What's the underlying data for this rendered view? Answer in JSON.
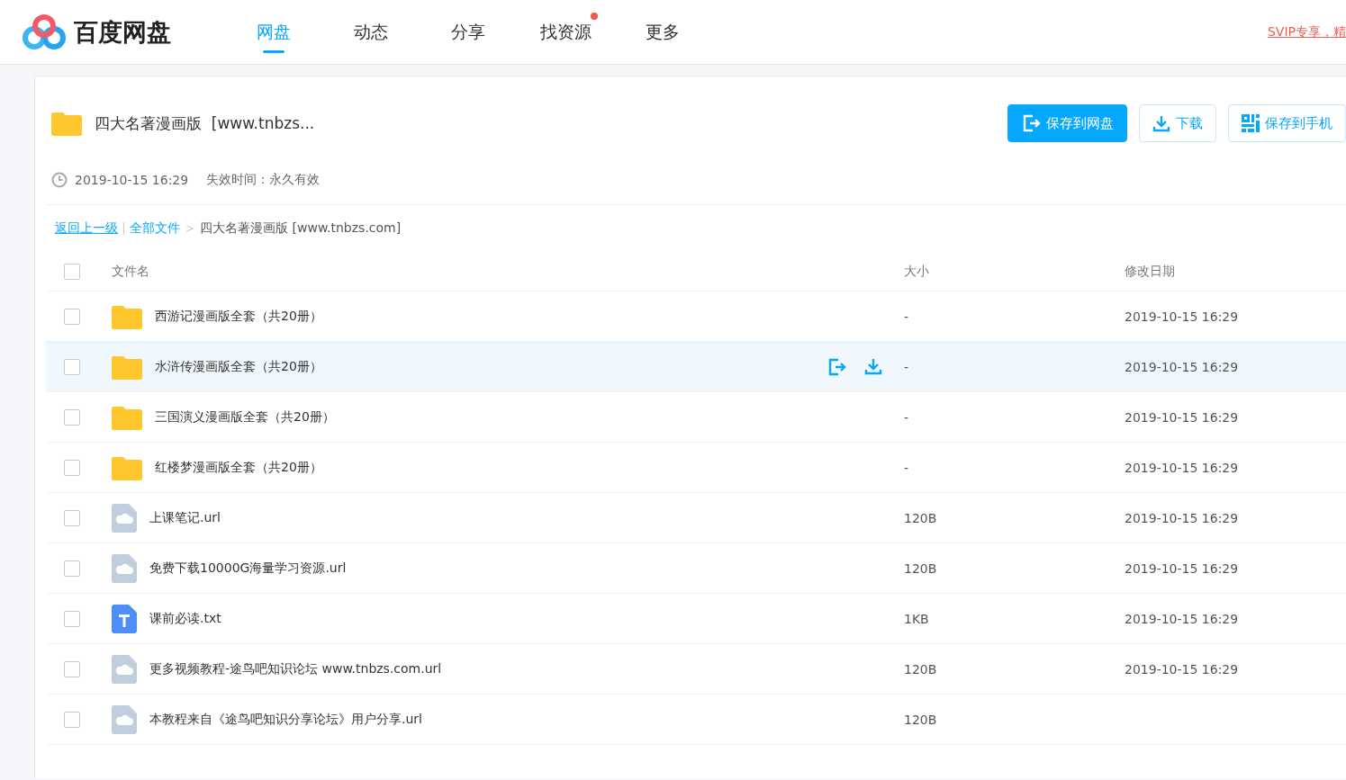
{
  "header": {
    "logo_text": "百度网盘",
    "nav": [
      {
        "label": "网盘",
        "selected": true,
        "dot": false
      },
      {
        "label": "动态",
        "selected": false,
        "dot": false
      },
      {
        "label": "分享",
        "selected": false,
        "dot": false
      },
      {
        "label": "找资源",
        "selected": false,
        "dot": true
      },
      {
        "label": "更多",
        "selected": false,
        "dot": false
      }
    ],
    "promo_link": "SVIP专享，精"
  },
  "share": {
    "title": "四大名著漫画版  [www.tnbzs...",
    "time": "2019-10-15 16:29",
    "expiry": "失效时间：永久有效",
    "actions": [
      {
        "kind": "save",
        "label": "保存到网盘",
        "primary": true
      },
      {
        "kind": "download",
        "label": "下载",
        "primary": false
      },
      {
        "kind": "phone",
        "label": "保存到手机",
        "primary": false
      }
    ]
  },
  "breadcrumb": {
    "back": "返回上一级",
    "root": "全部文件",
    "separator": ">",
    "current": "四大名著漫画版 [www.tnbzs.com]"
  },
  "table": {
    "columns": [
      "文件名",
      "大小",
      "修改日期"
    ],
    "all_checked": false,
    "rows": [
      {
        "kind": "folder",
        "name": "西游记漫画版全套（共20册）",
        "size": "-",
        "date": "2019-10-15 16:29",
        "checked": false,
        "hovered": false
      },
      {
        "kind": "folder",
        "name": "水浒传漫画版全套（共20册）",
        "size": "-",
        "date": "2019-10-15 16:29",
        "checked": false,
        "hovered": true
      },
      {
        "kind": "folder",
        "name": "三国演义漫画版全套（共20册）",
        "size": "-",
        "date": "2019-10-15 16:29",
        "checked": false,
        "hovered": false
      },
      {
        "kind": "folder",
        "name": "红楼梦漫画版全套（共20册）",
        "size": "-",
        "date": "2019-10-15 16:29",
        "checked": false,
        "hovered": false
      },
      {
        "kind": "url",
        "name": "上课笔记.url",
        "size": "120B",
        "date": "2019-10-15 16:29",
        "checked": false,
        "hovered": false
      },
      {
        "kind": "url",
        "name": "免费下载10000G海量学习资源.url",
        "size": "120B",
        "date": "2019-10-15 16:29",
        "checked": false,
        "hovered": false
      },
      {
        "kind": "txt",
        "name": "课前必读.txt",
        "size": "1KB",
        "date": "2019-10-15 16:29",
        "checked": false,
        "hovered": false
      },
      {
        "kind": "url",
        "name": "更多视频教程-途鸟吧知识论坛 www.tnbzs.com.url",
        "size": "120B",
        "date": "2019-10-15 16:29",
        "checked": false,
        "hovered": false
      },
      {
        "kind": "url",
        "name": "本教程来自《途鸟吧知识分享论坛》用户分享.url",
        "size": "120B",
        "date": "",
        "checked": false,
        "hovered": false
      }
    ]
  }
}
